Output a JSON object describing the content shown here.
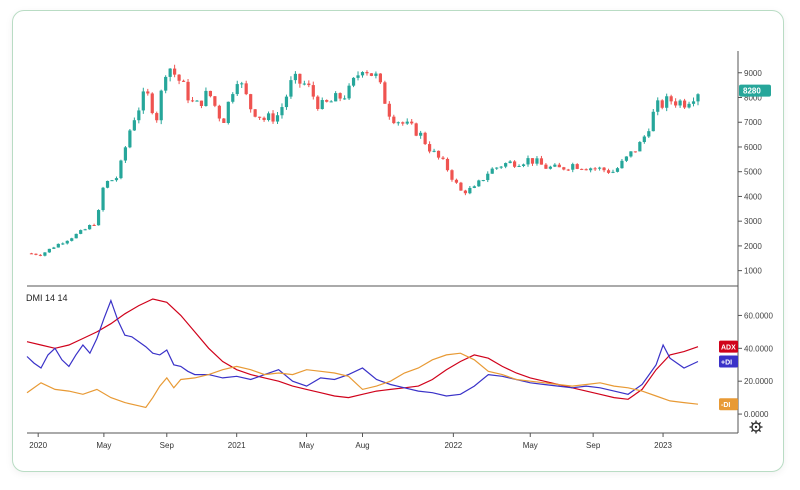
{
  "indicator_label": "DMI 14 14",
  "price_badge": "8280",
  "colors": {
    "up": "#26a69a",
    "down": "#ef5350",
    "adx": "#d0021b",
    "plus_di": "#3a32c8",
    "minus_di": "#e89a35",
    "axis": "#333333",
    "card_border": "#b9dcc4"
  },
  "chart_data": [
    {
      "type": "candlestick",
      "title": "",
      "ylim": [
        500,
        9800
      ],
      "y_ticks": [
        1000,
        2000,
        3000,
        4000,
        5000,
        6000,
        7000,
        8000,
        9000
      ],
      "y_tick_labels": [
        "1000",
        "2000",
        "3000",
        "4000",
        "5000",
        "6000",
        "7000",
        "8000",
        "9000"
      ],
      "last_price": 8280,
      "x_ticks": [
        {
          "label": "2020",
          "t": 0.08
        },
        {
          "label": "May",
          "t": 0.55
        },
        {
          "label": "Sep",
          "t": 1.0
        },
        {
          "label": "2021",
          "t": 1.5
        },
        {
          "label": "May",
          "t": 2.0
        },
        {
          "label": "Aug",
          "t": 2.4
        },
        {
          "label": "2022",
          "t": 3.05
        },
        {
          "label": "May",
          "t": 3.6
        },
        {
          "label": "Sep",
          "t": 4.05
        },
        {
          "label": "2023",
          "t": 4.55
        }
      ],
      "close_path": [
        [
          0.0,
          1700
        ],
        [
          0.1,
          1650
        ],
        [
          0.2,
          2000
        ],
        [
          0.3,
          2300
        ],
        [
          0.4,
          2600
        ],
        [
          0.5,
          3000
        ],
        [
          0.55,
          4500
        ],
        [
          0.65,
          4800
        ],
        [
          0.75,
          7000
        ],
        [
          0.85,
          8200
        ],
        [
          0.93,
          7200
        ],
        [
          1.0,
          9400
        ],
        [
          1.1,
          8600
        ],
        [
          1.2,
          7600
        ],
        [
          1.3,
          8200
        ],
        [
          1.4,
          7000
        ],
        [
          1.5,
          8900
        ],
        [
          1.6,
          7600
        ],
        [
          1.7,
          7100
        ],
        [
          1.8,
          7300
        ],
        [
          1.9,
          8700
        ],
        [
          2.0,
          8500
        ],
        [
          2.1,
          7600
        ],
        [
          2.2,
          7900
        ],
        [
          2.3,
          8200
        ],
        [
          2.4,
          9300
        ],
        [
          2.5,
          8800
        ],
        [
          2.6,
          7300
        ],
        [
          2.7,
          6900
        ],
        [
          2.8,
          6600
        ],
        [
          2.9,
          5800
        ],
        [
          3.0,
          5200
        ],
        [
          3.1,
          4200
        ],
        [
          3.2,
          4300
        ],
        [
          3.3,
          5000
        ],
        [
          3.4,
          5300
        ],
        [
          3.5,
          5400
        ],
        [
          3.6,
          5500
        ],
        [
          3.7,
          5200
        ],
        [
          3.8,
          5100
        ],
        [
          3.9,
          5300
        ],
        [
          4.0,
          5200
        ],
        [
          4.1,
          5100
        ],
        [
          4.2,
          5000
        ],
        [
          4.3,
          5600
        ],
        [
          4.4,
          6200
        ],
        [
          4.5,
          7600
        ],
        [
          4.6,
          7900
        ],
        [
          4.7,
          7800
        ],
        [
          4.8,
          8280
        ]
      ]
    },
    {
      "type": "line",
      "title": "DMI 14 14",
      "ylim": [
        -3,
        70
      ],
      "y_ticks": [
        0,
        20,
        40,
        60
      ],
      "y_tick_labels": [
        "0.0000",
        "20.0000",
        "40.0000",
        "60.0000"
      ],
      "series": [
        {
          "name": "ADX",
          "color": "#d0021b",
          "points": [
            [
              0.0,
              44
            ],
            [
              0.1,
              42
            ],
            [
              0.2,
              40
            ],
            [
              0.3,
              42
            ],
            [
              0.4,
              46
            ],
            [
              0.5,
              50
            ],
            [
              0.6,
              55
            ],
            [
              0.7,
              61
            ],
            [
              0.8,
              66
            ],
            [
              0.9,
              70
            ],
            [
              1.0,
              68
            ],
            [
              1.1,
              60
            ],
            [
              1.2,
              50
            ],
            [
              1.3,
              40
            ],
            [
              1.4,
              32
            ],
            [
              1.5,
              27
            ],
            [
              1.6,
              24
            ],
            [
              1.7,
              22
            ],
            [
              1.8,
              20
            ],
            [
              1.9,
              17
            ],
            [
              2.0,
              15
            ],
            [
              2.1,
              13
            ],
            [
              2.2,
              11
            ],
            [
              2.3,
              10
            ],
            [
              2.4,
              12
            ],
            [
              2.5,
              14
            ],
            [
              2.6,
              15
            ],
            [
              2.7,
              16
            ],
            [
              2.8,
              17
            ],
            [
              2.9,
              21
            ],
            [
              3.0,
              27
            ],
            [
              3.1,
              32
            ],
            [
              3.2,
              36
            ],
            [
              3.3,
              34
            ],
            [
              3.4,
              29
            ],
            [
              3.5,
              25
            ],
            [
              3.6,
              22
            ],
            [
              3.7,
              20
            ],
            [
              3.8,
              18
            ],
            [
              3.9,
              16
            ],
            [
              4.0,
              14
            ],
            [
              4.1,
              12
            ],
            [
              4.2,
              10
            ],
            [
              4.3,
              9
            ],
            [
              4.4,
              15
            ],
            [
              4.5,
              27
            ],
            [
              4.6,
              36
            ],
            [
              4.7,
              38
            ],
            [
              4.8,
              41
            ]
          ]
        },
        {
          "name": "+DI",
          "color": "#3a32c8",
          "points": [
            [
              0.0,
              35
            ],
            [
              0.05,
              31
            ],
            [
              0.1,
              28
            ],
            [
              0.15,
              36
            ],
            [
              0.2,
              40
            ],
            [
              0.25,
              33
            ],
            [
              0.3,
              29
            ],
            [
              0.35,
              36
            ],
            [
              0.4,
              42
            ],
            [
              0.45,
              37
            ],
            [
              0.5,
              46
            ],
            [
              0.55,
              58
            ],
            [
              0.6,
              69
            ],
            [
              0.65,
              57
            ],
            [
              0.7,
              48
            ],
            [
              0.75,
              47
            ],
            [
              0.8,
              44
            ],
            [
              0.85,
              41
            ],
            [
              0.9,
              37
            ],
            [
              0.95,
              36
            ],
            [
              1.0,
              39
            ],
            [
              1.05,
              30
            ],
            [
              1.1,
              29
            ],
            [
              1.15,
              26
            ],
            [
              1.2,
              24
            ],
            [
              1.3,
              24
            ],
            [
              1.4,
              22
            ],
            [
              1.5,
              23
            ],
            [
              1.6,
              21
            ],
            [
              1.7,
              24
            ],
            [
              1.8,
              27
            ],
            [
              1.9,
              20
            ],
            [
              2.0,
              17
            ],
            [
              2.1,
              22
            ],
            [
              2.2,
              21
            ],
            [
              2.3,
              24
            ],
            [
              2.4,
              28
            ],
            [
              2.5,
              21
            ],
            [
              2.6,
              18
            ],
            [
              2.7,
              16
            ],
            [
              2.8,
              14
            ],
            [
              2.9,
              13
            ],
            [
              3.0,
              11
            ],
            [
              3.1,
              12
            ],
            [
              3.2,
              17
            ],
            [
              3.3,
              24
            ],
            [
              3.4,
              23
            ],
            [
              3.5,
              21
            ],
            [
              3.6,
              19
            ],
            [
              3.7,
              18
            ],
            [
              3.8,
              17
            ],
            [
              3.9,
              16
            ],
            [
              4.0,
              17
            ],
            [
              4.1,
              16
            ],
            [
              4.2,
              14
            ],
            [
              4.3,
              12
            ],
            [
              4.4,
              18
            ],
            [
              4.5,
              30
            ],
            [
              4.55,
              42
            ],
            [
              4.6,
              34
            ],
            [
              4.7,
              28
            ],
            [
              4.8,
              32
            ]
          ]
        },
        {
          "name": "-DI",
          "color": "#e89a35",
          "points": [
            [
              0.0,
              13
            ],
            [
              0.05,
              16
            ],
            [
              0.1,
              19
            ],
            [
              0.2,
              15
            ],
            [
              0.3,
              14
            ],
            [
              0.4,
              12
            ],
            [
              0.5,
              15
            ],
            [
              0.6,
              10
            ],
            [
              0.7,
              7
            ],
            [
              0.8,
              5
            ],
            [
              0.85,
              4
            ],
            [
              0.9,
              10
            ],
            [
              0.95,
              17
            ],
            [
              1.0,
              22
            ],
            [
              1.05,
              16
            ],
            [
              1.1,
              21
            ],
            [
              1.2,
              22
            ],
            [
              1.3,
              24
            ],
            [
              1.4,
              27
            ],
            [
              1.5,
              29
            ],
            [
              1.6,
              27
            ],
            [
              1.7,
              24
            ],
            [
              1.8,
              25
            ],
            [
              1.9,
              24
            ],
            [
              2.0,
              27
            ],
            [
              2.1,
              26
            ],
            [
              2.2,
              25
            ],
            [
              2.3,
              23
            ],
            [
              2.4,
              15
            ],
            [
              2.5,
              17
            ],
            [
              2.6,
              20
            ],
            [
              2.7,
              25
            ],
            [
              2.8,
              28
            ],
            [
              2.9,
              33
            ],
            [
              3.0,
              36
            ],
            [
              3.1,
              37
            ],
            [
              3.2,
              33
            ],
            [
              3.3,
              26
            ],
            [
              3.4,
              24
            ],
            [
              3.5,
              21
            ],
            [
              3.6,
              20
            ],
            [
              3.7,
              19
            ],
            [
              3.8,
              18
            ],
            [
              3.9,
              17
            ],
            [
              4.0,
              18
            ],
            [
              4.1,
              19
            ],
            [
              4.2,
              17
            ],
            [
              4.3,
              16
            ],
            [
              4.4,
              14
            ],
            [
              4.5,
              11
            ],
            [
              4.6,
              8
            ],
            [
              4.7,
              7
            ],
            [
              4.8,
              6
            ]
          ]
        }
      ],
      "legend": [
        {
          "label": "ADX",
          "color": "#d0021b",
          "value": 41
        },
        {
          "label": "+DI",
          "color": "#3a32c8",
          "value": 32
        },
        {
          "label": "-DI",
          "color": "#e89a35",
          "value": 6
        }
      ]
    }
  ]
}
